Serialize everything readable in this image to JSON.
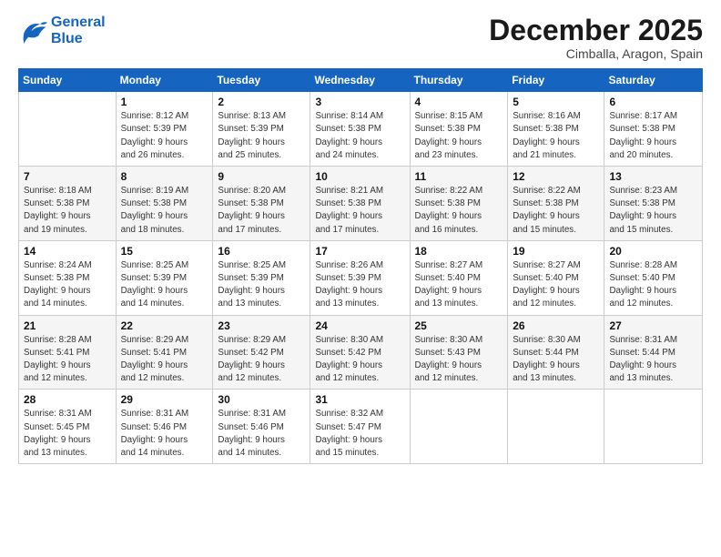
{
  "logo": {
    "line1": "General",
    "line2": "Blue"
  },
  "title": "December 2025",
  "subtitle": "Cimballa, Aragon, Spain",
  "weekdays": [
    "Sunday",
    "Monday",
    "Tuesday",
    "Wednesday",
    "Thursday",
    "Friday",
    "Saturday"
  ],
  "weeks": [
    [
      {
        "day": "",
        "info": ""
      },
      {
        "day": "1",
        "info": "Sunrise: 8:12 AM\nSunset: 5:39 PM\nDaylight: 9 hours\nand 26 minutes."
      },
      {
        "day": "2",
        "info": "Sunrise: 8:13 AM\nSunset: 5:39 PM\nDaylight: 9 hours\nand 25 minutes."
      },
      {
        "day": "3",
        "info": "Sunrise: 8:14 AM\nSunset: 5:38 PM\nDaylight: 9 hours\nand 24 minutes."
      },
      {
        "day": "4",
        "info": "Sunrise: 8:15 AM\nSunset: 5:38 PM\nDaylight: 9 hours\nand 23 minutes."
      },
      {
        "day": "5",
        "info": "Sunrise: 8:16 AM\nSunset: 5:38 PM\nDaylight: 9 hours\nand 21 minutes."
      },
      {
        "day": "6",
        "info": "Sunrise: 8:17 AM\nSunset: 5:38 PM\nDaylight: 9 hours\nand 20 minutes."
      }
    ],
    [
      {
        "day": "7",
        "info": "Sunrise: 8:18 AM\nSunset: 5:38 PM\nDaylight: 9 hours\nand 19 minutes."
      },
      {
        "day": "8",
        "info": "Sunrise: 8:19 AM\nSunset: 5:38 PM\nDaylight: 9 hours\nand 18 minutes."
      },
      {
        "day": "9",
        "info": "Sunrise: 8:20 AM\nSunset: 5:38 PM\nDaylight: 9 hours\nand 17 minutes."
      },
      {
        "day": "10",
        "info": "Sunrise: 8:21 AM\nSunset: 5:38 PM\nDaylight: 9 hours\nand 17 minutes."
      },
      {
        "day": "11",
        "info": "Sunrise: 8:22 AM\nSunset: 5:38 PM\nDaylight: 9 hours\nand 16 minutes."
      },
      {
        "day": "12",
        "info": "Sunrise: 8:22 AM\nSunset: 5:38 PM\nDaylight: 9 hours\nand 15 minutes."
      },
      {
        "day": "13",
        "info": "Sunrise: 8:23 AM\nSunset: 5:38 PM\nDaylight: 9 hours\nand 15 minutes."
      }
    ],
    [
      {
        "day": "14",
        "info": "Sunrise: 8:24 AM\nSunset: 5:38 PM\nDaylight: 9 hours\nand 14 minutes."
      },
      {
        "day": "15",
        "info": "Sunrise: 8:25 AM\nSunset: 5:39 PM\nDaylight: 9 hours\nand 14 minutes."
      },
      {
        "day": "16",
        "info": "Sunrise: 8:25 AM\nSunset: 5:39 PM\nDaylight: 9 hours\nand 13 minutes."
      },
      {
        "day": "17",
        "info": "Sunrise: 8:26 AM\nSunset: 5:39 PM\nDaylight: 9 hours\nand 13 minutes."
      },
      {
        "day": "18",
        "info": "Sunrise: 8:27 AM\nSunset: 5:40 PM\nDaylight: 9 hours\nand 13 minutes."
      },
      {
        "day": "19",
        "info": "Sunrise: 8:27 AM\nSunset: 5:40 PM\nDaylight: 9 hours\nand 12 minutes."
      },
      {
        "day": "20",
        "info": "Sunrise: 8:28 AM\nSunset: 5:40 PM\nDaylight: 9 hours\nand 12 minutes."
      }
    ],
    [
      {
        "day": "21",
        "info": "Sunrise: 8:28 AM\nSunset: 5:41 PM\nDaylight: 9 hours\nand 12 minutes."
      },
      {
        "day": "22",
        "info": "Sunrise: 8:29 AM\nSunset: 5:41 PM\nDaylight: 9 hours\nand 12 minutes."
      },
      {
        "day": "23",
        "info": "Sunrise: 8:29 AM\nSunset: 5:42 PM\nDaylight: 9 hours\nand 12 minutes."
      },
      {
        "day": "24",
        "info": "Sunrise: 8:30 AM\nSunset: 5:42 PM\nDaylight: 9 hours\nand 12 minutes."
      },
      {
        "day": "25",
        "info": "Sunrise: 8:30 AM\nSunset: 5:43 PM\nDaylight: 9 hours\nand 12 minutes."
      },
      {
        "day": "26",
        "info": "Sunrise: 8:30 AM\nSunset: 5:44 PM\nDaylight: 9 hours\nand 13 minutes."
      },
      {
        "day": "27",
        "info": "Sunrise: 8:31 AM\nSunset: 5:44 PM\nDaylight: 9 hours\nand 13 minutes."
      }
    ],
    [
      {
        "day": "28",
        "info": "Sunrise: 8:31 AM\nSunset: 5:45 PM\nDaylight: 9 hours\nand 13 minutes."
      },
      {
        "day": "29",
        "info": "Sunrise: 8:31 AM\nSunset: 5:46 PM\nDaylight: 9 hours\nand 14 minutes."
      },
      {
        "day": "30",
        "info": "Sunrise: 8:31 AM\nSunset: 5:46 PM\nDaylight: 9 hours\nand 14 minutes."
      },
      {
        "day": "31",
        "info": "Sunrise: 8:32 AM\nSunset: 5:47 PM\nDaylight: 9 hours\nand 15 minutes."
      },
      {
        "day": "",
        "info": ""
      },
      {
        "day": "",
        "info": ""
      },
      {
        "day": "",
        "info": ""
      }
    ]
  ]
}
